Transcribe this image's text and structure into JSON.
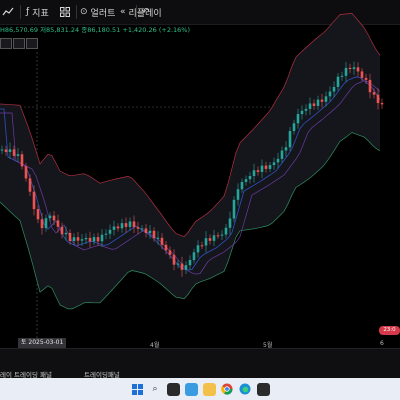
{
  "toolbar": {
    "indicators_label": "지표",
    "alerts_label": "얼러트",
    "replay_label": "리플레이",
    "undo_icon": "undo-icon"
  },
  "quote": {
    "high_prefix": "H",
    "high_value": "86,570.69",
    "low_prefix": "저",
    "low_value": "85,831.24",
    "close_prefix": "종",
    "close_value": "86,180.51",
    "change": "+1,420.26 (+2.16%)"
  },
  "axis": {
    "crosshair_date": "토 2025-03-01",
    "months": [
      "4월",
      "5월",
      "6"
    ]
  },
  "price_badge": "23:0",
  "bottom_panel": {
    "tab1": "레이 트레이딩 패널",
    "tab2": "트레이딩패널"
  },
  "colors": {
    "up": "#26a69a",
    "down": "#ef5350",
    "band": "#b03040",
    "ma": "#3050c0"
  }
}
